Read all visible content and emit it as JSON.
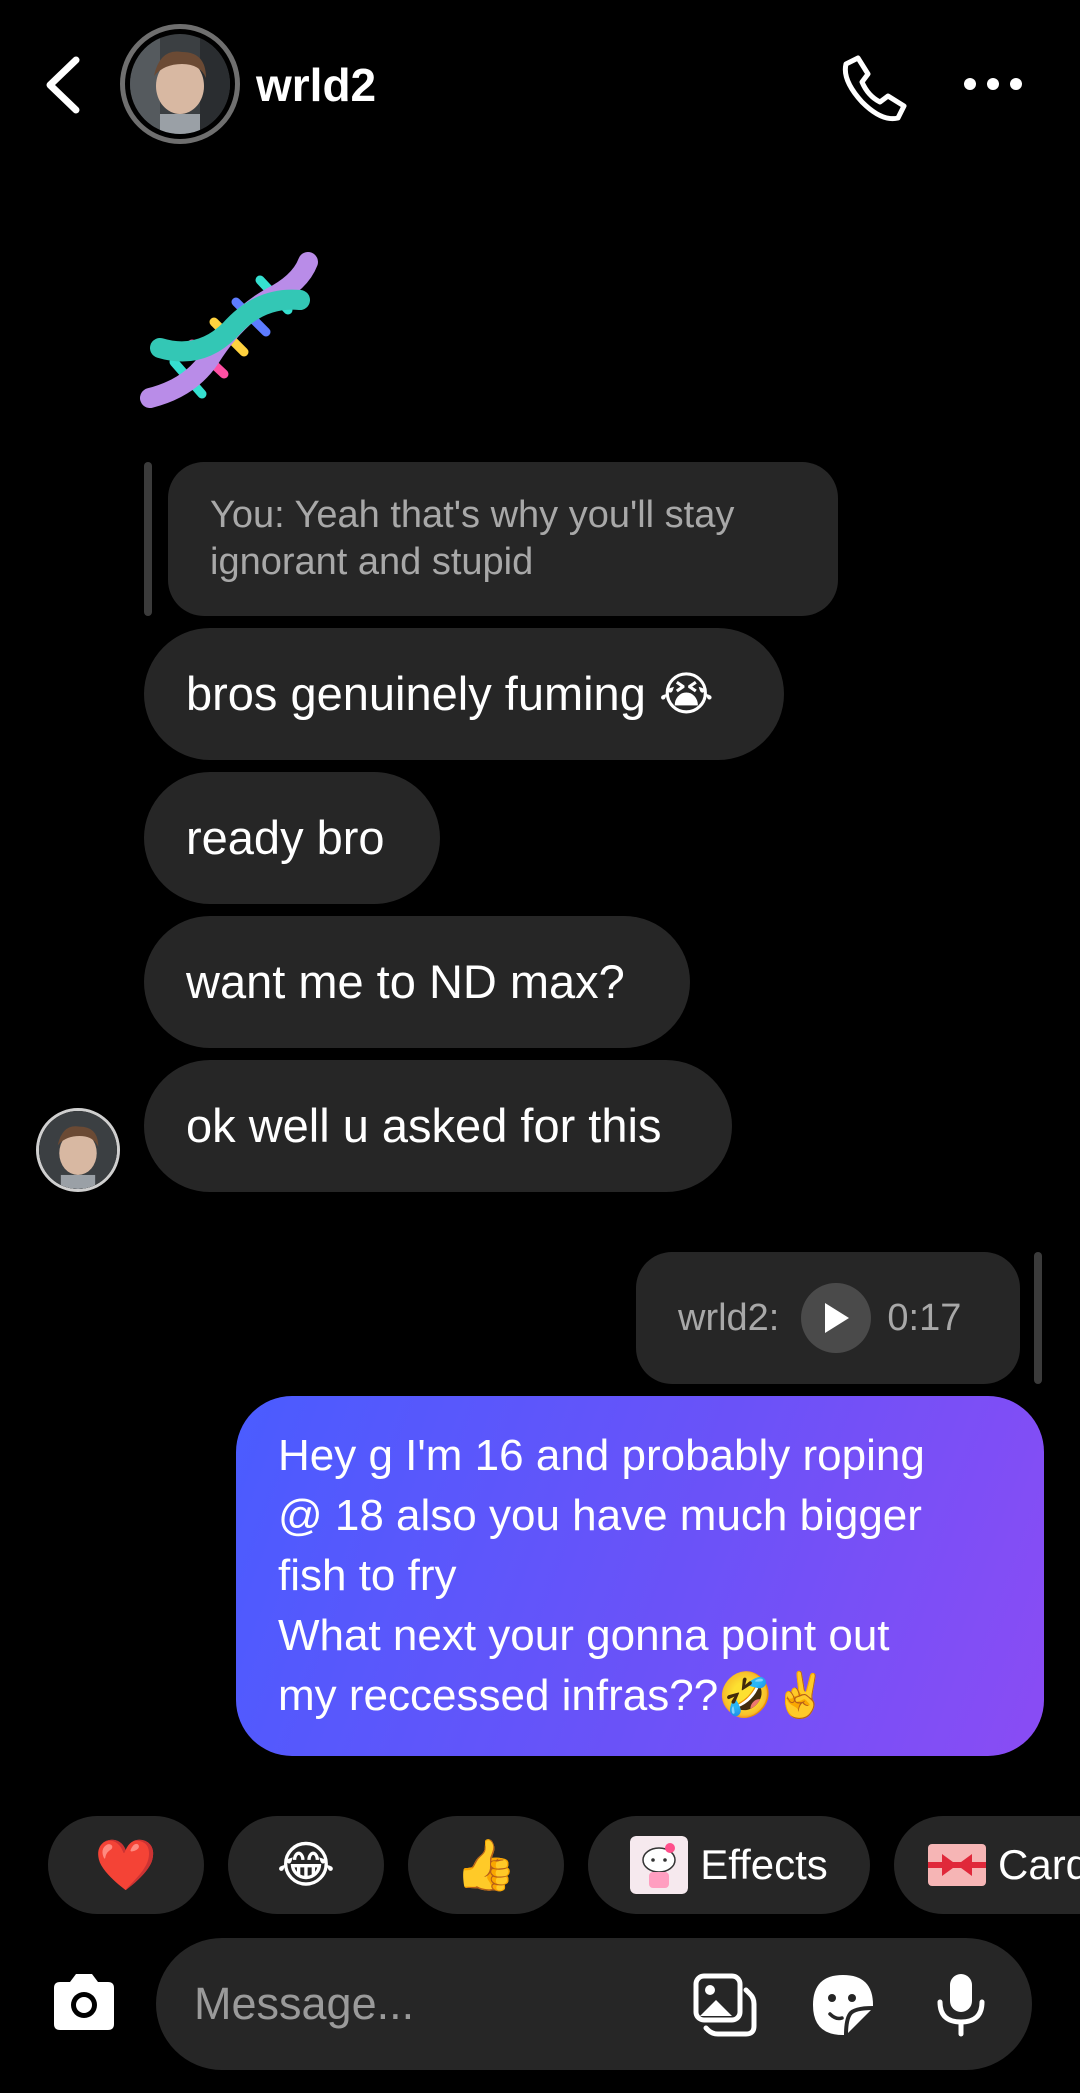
{
  "header": {
    "username": "wrld2"
  },
  "icons": {
    "back": "chevron-left-icon",
    "call": "phone-icon",
    "more": "more-horizontal-icon",
    "camera": "camera-icon",
    "gallery": "gallery-icon",
    "sticker": "sticker-icon",
    "mic": "microphone-icon"
  },
  "messages": {
    "reply_quote": "You: Yeah that's why you'll stay ignorant and stupid",
    "received": [
      "bros genuinely fuming 😭",
      "ready bro",
      "want me to ND max?",
      "ok well u asked for this"
    ],
    "voice_reply": {
      "sender": "wrld2:",
      "duration": "0:17"
    },
    "sent_lines": [
      "Hey g I'm 16 and probably roping",
      "@ 18 also you have much bigger",
      "fish to fry",
      "What next your gonna point out",
      "my reccessed infras??🤣✌️"
    ]
  },
  "quick_reactions": {
    "heart": "❤️",
    "laugh": "😂",
    "thumbs": "👍",
    "effects_label": "Effects",
    "cards_label": "Cards"
  },
  "composer": {
    "placeholder": "Message..."
  },
  "colors": {
    "background": "#000000",
    "bubble_received": "#262626",
    "sent_gradient_start": "#4a5cff",
    "sent_gradient_end": "#8a4cf4"
  }
}
